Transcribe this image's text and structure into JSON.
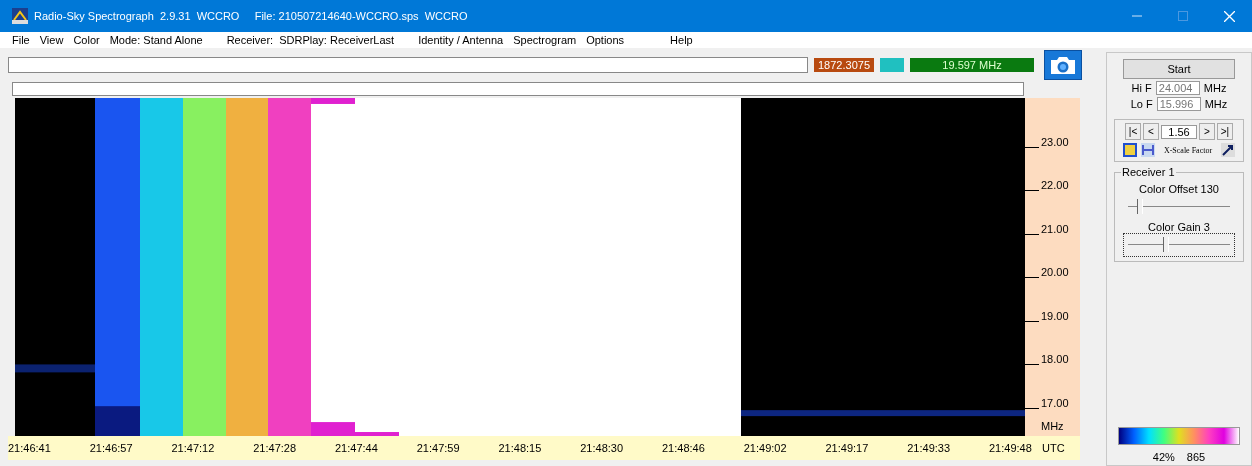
{
  "window": {
    "title": "Radio-Sky Spectrograph  2.9.31  WCCRO     File: 210507214640-WCCRO.sps  WCCRO"
  },
  "menu": [
    {
      "label": "File",
      "kind": "menu"
    },
    {
      "label": "View",
      "kind": "menu"
    },
    {
      "label": "Color",
      "kind": "menu"
    },
    {
      "label": "Mode: Stand Alone",
      "kind": "info"
    },
    {
      "label": "Receiver:  SDRPlay: ReceiverLast",
      "kind": "info"
    },
    {
      "label": "Identity / Antenna",
      "kind": "menu"
    },
    {
      "label": "Spectrogram",
      "kind": "menu"
    },
    {
      "label": "Options",
      "kind": "menu"
    },
    {
      "label": "Help",
      "kind": "menu"
    }
  ],
  "toolbar": {
    "count": "1872.3075",
    "frequency": "19.597 MHz"
  },
  "spectrogram": {
    "freq_ticks": [
      "23.00",
      "22.00",
      "21.00",
      "20.00",
      "19.00",
      "18.00",
      "17.00"
    ],
    "freq_unit": "MHz",
    "time_ticks": [
      "21:46:41",
      "21:46:57",
      "21:47:12",
      "21:47:28",
      "21:47:44",
      "21:47:59",
      "21:48:15",
      "21:48:30",
      "21:48:46",
      "21:49:02",
      "21:49:17",
      "21:49:33",
      "21:49:48"
    ],
    "time_unit": "UTC"
  },
  "panel": {
    "start": "Start",
    "hi_label": "Hi F",
    "hi_value": "24.004",
    "lo_label": "Lo F",
    "lo_value": "15.996",
    "hi_unit": "MHz",
    "lo_unit": "MHz",
    "x_scale": "1.56",
    "nav": [
      "|<",
      "<",
      ">",
      ">|"
    ],
    "x_scale_label": "X-Scale Factor",
    "receiver": {
      "title": "Receiver 1",
      "sliders": [
        {
          "label": "Color Offset 130",
          "level": 0.12,
          "focused": false
        },
        {
          "label": "Color Gain 3",
          "level": 0.35,
          "focused": true
        }
      ]
    },
    "percent": "42%",
    "value": "865"
  }
}
